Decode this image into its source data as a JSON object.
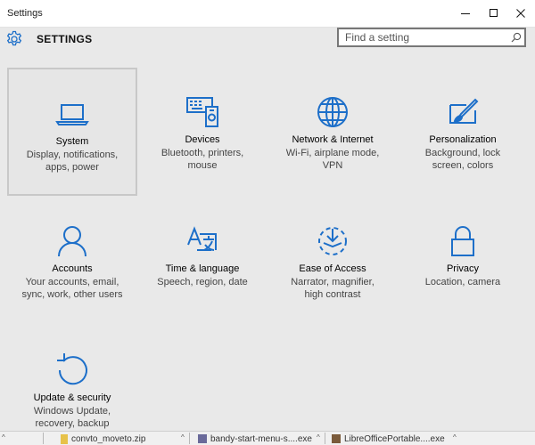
{
  "window": {
    "title": "Settings"
  },
  "header": {
    "heading": "SETTINGS"
  },
  "search": {
    "placeholder": "Find a setting"
  },
  "tiles": [
    {
      "label": "System",
      "desc_lines": [
        "Display, notifications,",
        "apps, power"
      ],
      "icon": "laptop-icon"
    },
    {
      "label": "Devices",
      "desc_lines": [
        "Bluetooth, printers,",
        "mouse"
      ],
      "icon": "devices-icon"
    },
    {
      "label": "Network & Internet",
      "desc_lines": [
        "Wi-Fi, airplane mode,",
        "VPN"
      ],
      "icon": "globe-icon"
    },
    {
      "label": "Personalization",
      "desc_lines": [
        "Background, lock",
        "screen, colors"
      ],
      "icon": "paintbrush-icon"
    },
    {
      "label": "Accounts",
      "desc_lines": [
        "Your accounts, email,",
        "sync, work, other users"
      ],
      "icon": "person-icon"
    },
    {
      "label": "Time & language",
      "desc_lines": [
        "Speech, region, date"
      ],
      "icon": "time-language-icon"
    },
    {
      "label": "Ease of Access",
      "desc_lines": [
        "Narrator, magnifier,",
        "high contrast"
      ],
      "icon": "ease-of-access-icon"
    },
    {
      "label": "Privacy",
      "desc_lines": [
        "Location, camera"
      ],
      "icon": "lock-icon"
    },
    {
      "label": "Update & security",
      "desc_lines": [
        "Windows Update,",
        "recovery, backup"
      ],
      "icon": "refresh-icon"
    }
  ],
  "taskbar": {
    "items": [
      {
        "name": "convto_moveto.zip"
      },
      {
        "name": "bandy-start-menu-s....exe"
      },
      {
        "name": "LibreOfficePortable....exe"
      }
    ]
  },
  "colors": {
    "accent": "#1d6fc9",
    "background": "#e9e9e9"
  }
}
